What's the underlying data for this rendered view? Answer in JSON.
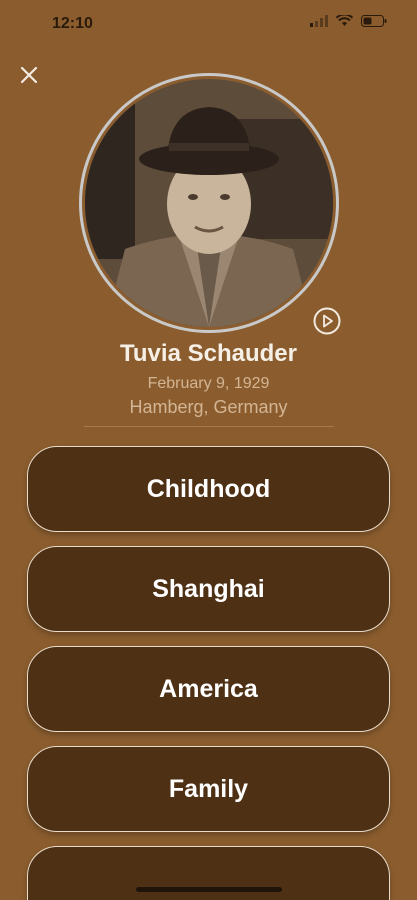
{
  "status": {
    "time": "12:10"
  },
  "profile": {
    "name": "Tuvia Schauder",
    "date": "February 9, 1929",
    "place": "Hamberg, Germany"
  },
  "chapters": [
    "Childhood",
    "Shanghai",
    "America",
    "Family",
    ""
  ],
  "colors": {
    "background": "#8b5d2e",
    "button": "#4e3014",
    "button_border": "#e9dccb"
  }
}
